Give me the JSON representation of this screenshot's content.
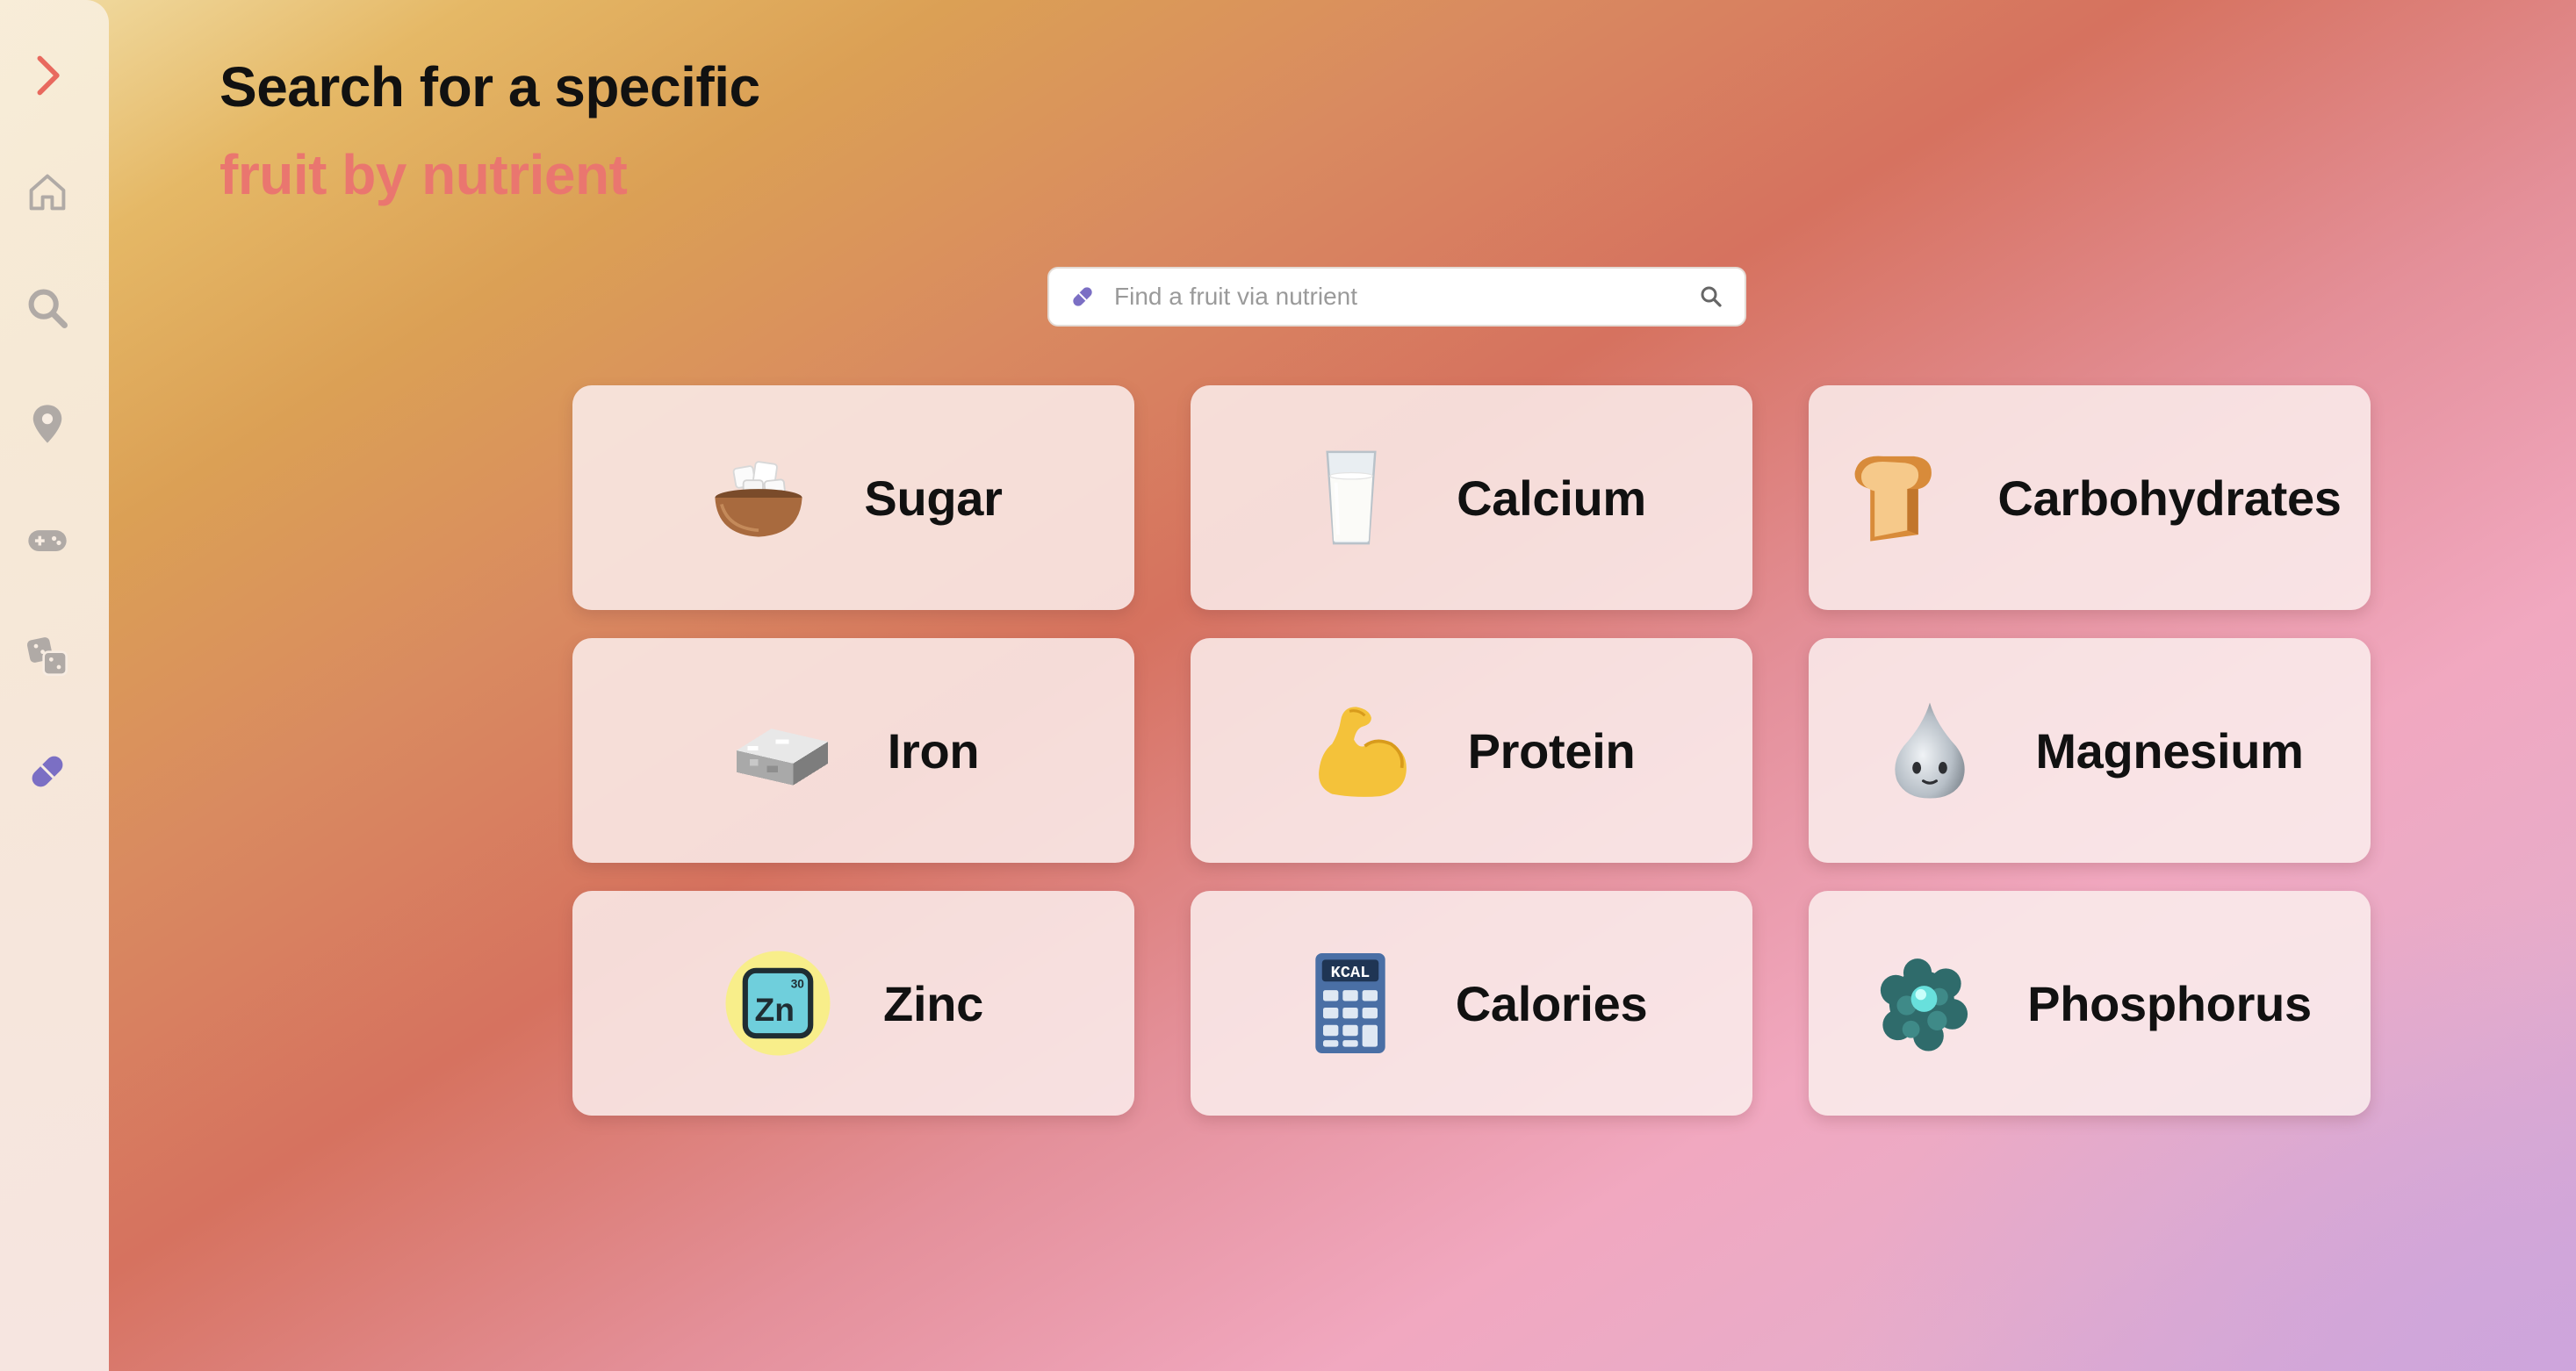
{
  "header": {
    "title_line1": "Search for a specific",
    "title_line2": "fruit by nutrient"
  },
  "search": {
    "placeholder": "Find a fruit via nutrient",
    "value": ""
  },
  "sidebar": {
    "items": [
      {
        "name": "expand",
        "icon": "chevron-right-icon"
      },
      {
        "name": "home",
        "icon": "home-icon"
      },
      {
        "name": "search",
        "icon": "search-icon"
      },
      {
        "name": "location",
        "icon": "map-pin-icon"
      },
      {
        "name": "games",
        "icon": "gamepad-icon"
      },
      {
        "name": "dice",
        "icon": "dice-icon"
      },
      {
        "name": "nutrients",
        "icon": "pill-icon",
        "active": true
      }
    ]
  },
  "nutrients": [
    {
      "label": "Sugar",
      "icon": "sugar-bowl-icon"
    },
    {
      "label": "Calcium",
      "icon": "milk-glass-icon"
    },
    {
      "label": "Carbohydrates",
      "icon": "bread-icon"
    },
    {
      "label": "Iron",
      "icon": "iron-ingot-icon"
    },
    {
      "label": "Protein",
      "icon": "flexed-bicep-icon"
    },
    {
      "label": "Magnesium",
      "icon": "droplet-face-icon"
    },
    {
      "label": "Zinc",
      "icon": "zinc-element-icon"
    },
    {
      "label": "Calories",
      "icon": "kcal-calculator-icon"
    },
    {
      "label": "Phosphorus",
      "icon": "molecule-cluster-icon"
    }
  ],
  "zinc_icon_text": {
    "symbol": "Zn",
    "number": "30"
  },
  "calories_icon_text": "KCAL",
  "colors": {
    "accent": "#ea766f",
    "active_icon": "#7b6fc4",
    "inactive_icon": "#b0aaa6"
  }
}
